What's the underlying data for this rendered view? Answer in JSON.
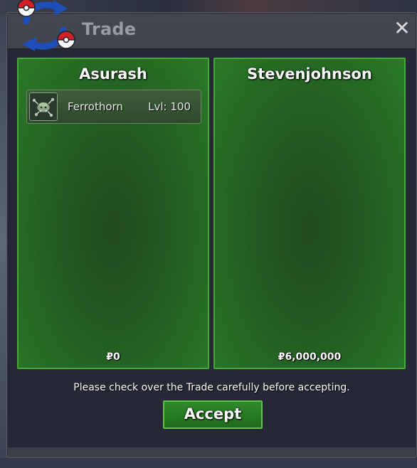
{
  "window": {
    "title": "Trade",
    "close_glyph": "✕"
  },
  "icons": {
    "trade_icon": "trade-arrows-pokeball-icon",
    "close_icon": "close-icon"
  },
  "colors": {
    "panel_green": "#235c22",
    "panel_border": "#47a73b",
    "accept_green": "#2f8a2a",
    "window_dark": "#262836",
    "title_gray": "#9a9ca4",
    "arrow_blue": "#1e4fb8",
    "pokeball_red": "#d4202a"
  },
  "trade": {
    "left": {
      "player": "Asurash",
      "items": [
        {
          "name": "Ferrothorn",
          "level": "Lvl: 100",
          "sprite": "ferrothorn-sprite-icon"
        }
      ],
      "money": "₽0"
    },
    "right": {
      "player": "Stevenjohnson",
      "items": [],
      "money": "₽6,000,000"
    }
  },
  "notice": "Please check over the Trade carefully before accepting.",
  "accept_label": "Accept"
}
